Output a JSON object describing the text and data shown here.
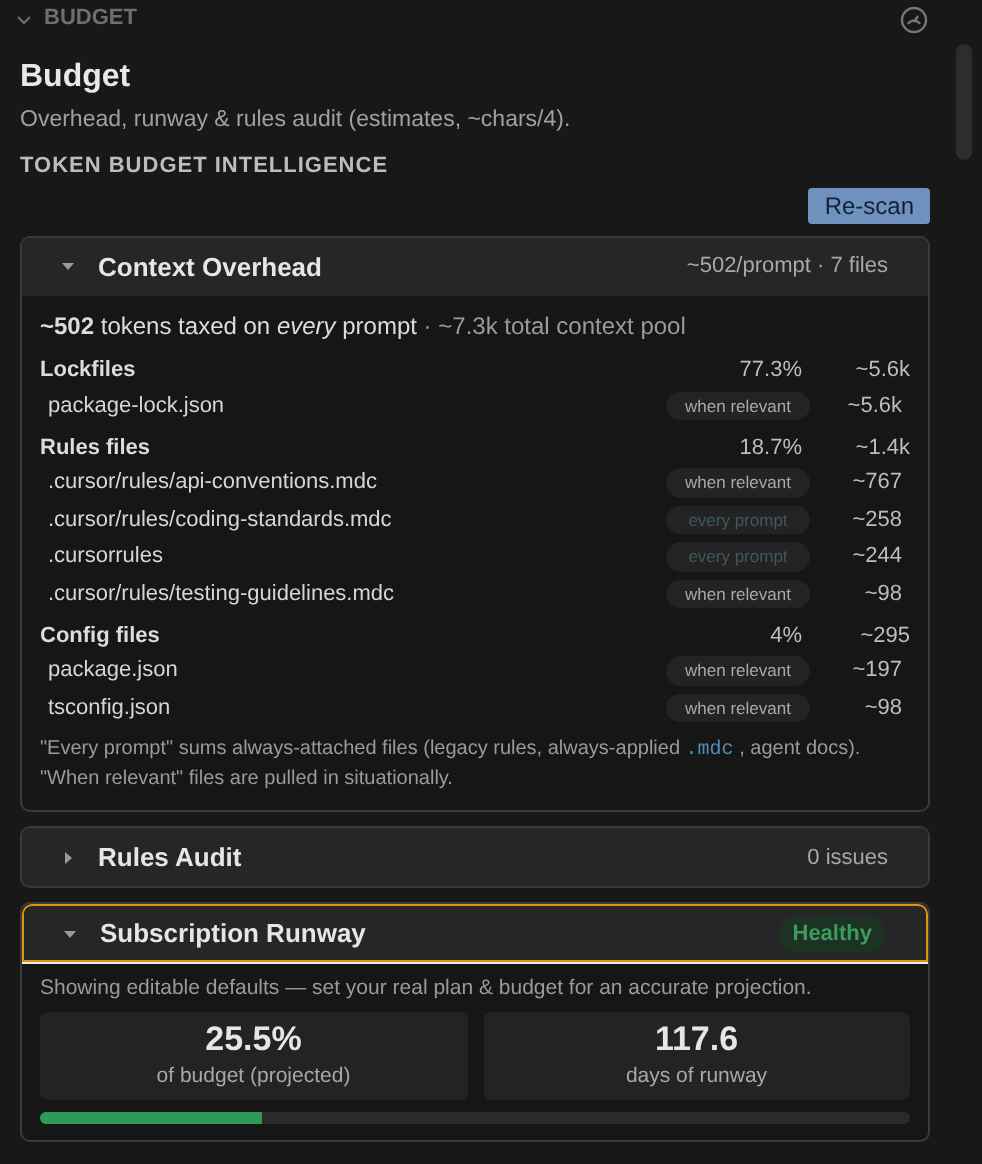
{
  "panel": {
    "header": "BUDGET",
    "expanded": true
  },
  "title": "Budget",
  "subtitle": "Overhead, runway & rules audit (estimates, ~chars/4).",
  "section_heading": "TOKEN BUDGET INTELLIGENCE",
  "rescan_button": "Re-scan",
  "context_overhead": {
    "title": "Context Overhead",
    "summary": "~502/prompt · 7 files",
    "expanded": true,
    "headline": "**~502** tokens taxed on *every* prompt",
    "headline_extra": " · ~7.3k total context pool",
    "groups": [
      {
        "name": "Lockfiles",
        "share": "77.3%",
        "tokens": "~5.6k",
        "files": [
          {
            "path": "package-lock.json",
            "badge": "when relevant",
            "kind": "relevant",
            "tokens": "~5.6k"
          }
        ]
      },
      {
        "name": "Rules files",
        "share": "18.7%",
        "tokens": "~1.4k",
        "files": [
          {
            "path": ".cursor/rules/api-conventions.mdc",
            "badge": "when relevant",
            "kind": "relevant",
            "tokens": "~767"
          },
          {
            "path": ".cursor/rules/coding-standards.mdc",
            "badge": "every prompt",
            "kind": "every",
            "tokens": "~258"
          },
          {
            "path": ".cursorrules",
            "badge": "every prompt",
            "kind": "every",
            "tokens": "~244"
          },
          {
            "path": ".cursor/rules/testing-guidelines.mdc",
            "badge": "when relevant",
            "kind": "relevant",
            "tokens": "~98"
          }
        ]
      },
      {
        "name": "Config files",
        "share": "4%",
        "tokens": "~295",
        "files": [
          {
            "path": "package.json",
            "badge": "when relevant",
            "kind": "relevant",
            "tokens": "~197"
          },
          {
            "path": "tsconfig.json",
            "badge": "when relevant",
            "kind": "relevant",
            "tokens": "~98"
          }
        ]
      }
    ],
    "note_before": "\"Every prompt\" sums always-attached files (legacy rules, always-applied ",
    "note_code": ".mdc",
    "note_after": " , agent docs). \"When relevant\" files are pulled in situationally."
  },
  "rules_audit": {
    "title": "Rules Audit",
    "summary": "0 issues",
    "expanded": false
  },
  "runway": {
    "title": "Subscription Runway",
    "status": "Healthy",
    "expanded": true,
    "focused": true,
    "note": "Showing editable defaults — set your real plan & budget for an accurate projection.",
    "stats": [
      {
        "value": "25.5%",
        "label": "of budget (projected)"
      },
      {
        "value": "117.6",
        "label": "days of runway"
      }
    ],
    "level": 0.255
  }
}
